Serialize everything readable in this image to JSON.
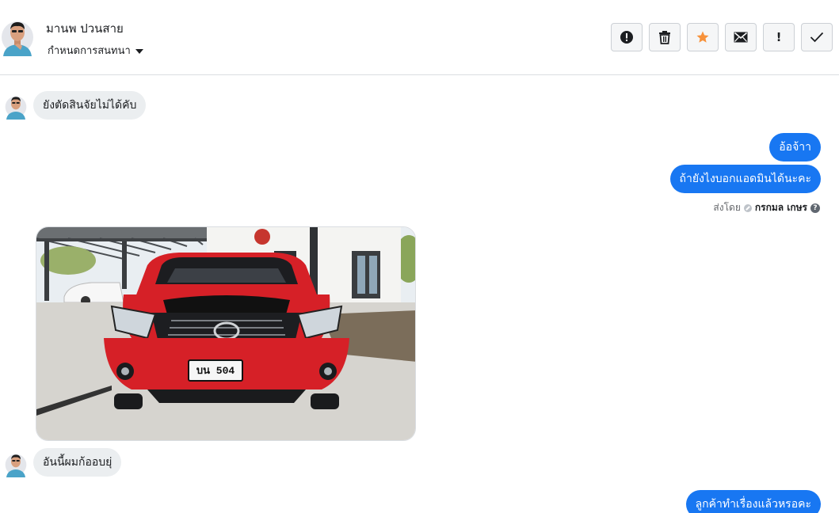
{
  "header": {
    "customer_name": "มานพ ปวนสาย",
    "assign_label": "กำหนดการสนทนา"
  },
  "toolbar": {
    "icons": [
      "alert-icon",
      "trash-icon",
      "star-icon",
      "mail-icon",
      "exclamation-icon",
      "check-icon"
    ],
    "exclamation_text": "!",
    "star_color": "#f7923b"
  },
  "messages": [
    {
      "direction": "incoming",
      "text": "ยังตัดสินจัยไม่ได้คับ"
    },
    {
      "direction": "outgoing",
      "text": "อ้อจ้าา"
    },
    {
      "direction": "outgoing",
      "text": "ถ้ายังไงบอกแอดมินได้นะคะ"
    },
    {
      "direction": "incoming",
      "type": "image",
      "plate_text": "บน 504"
    },
    {
      "direction": "incoming",
      "text": "อันนี้ผมก้ออบยุ่"
    },
    {
      "direction": "outgoing",
      "text": "ลูกค้าทำเรื่องแล้วหรอคะ"
    }
  ],
  "sent_by": {
    "label": "ส่งโดย",
    "agent": "กรกมล เกษร",
    "help": "?"
  },
  "colors": {
    "outgoing_bubble": "#1877f2",
    "incoming_bubble": "#ebeef0",
    "car_red": "#d62027"
  }
}
